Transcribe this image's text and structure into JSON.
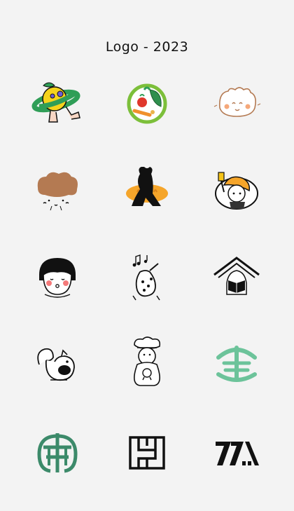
{
  "page": {
    "title": "Logo - 2023"
  },
  "colors": {
    "background": "#f3f3f3",
    "ink": "#111111",
    "green": "#2f9e57",
    "yellow": "#f5c418",
    "orange": "#f59e1b",
    "brown": "#b47a52",
    "teal": "#6cc39a",
    "dark_green": "#3c8a6a"
  },
  "logos": [
    {
      "icon": "lemon-planet-character-icon"
    },
    {
      "icon": "salad-bowl-icon"
    },
    {
      "icon": "dumpling-face-icon"
    },
    {
      "icon": "mushroom-cloud-face-icon"
    },
    {
      "icon": "bear-bread-icon"
    },
    {
      "icon": "chef-girl-spatula-icon"
    },
    {
      "icon": "bob-hair-girl-icon"
    },
    {
      "icon": "music-gourd-icon"
    },
    {
      "icon": "house-reader-icon"
    },
    {
      "icon": "squirrel-icon"
    },
    {
      "icon": "chef-bear-icon"
    },
    {
      "icon": "green-character-mark-icon"
    },
    {
      "icon": "green-seal-character-icon"
    },
    {
      "icon": "maze-square-icon"
    },
    {
      "icon": "geometric-letters-icon"
    }
  ]
}
